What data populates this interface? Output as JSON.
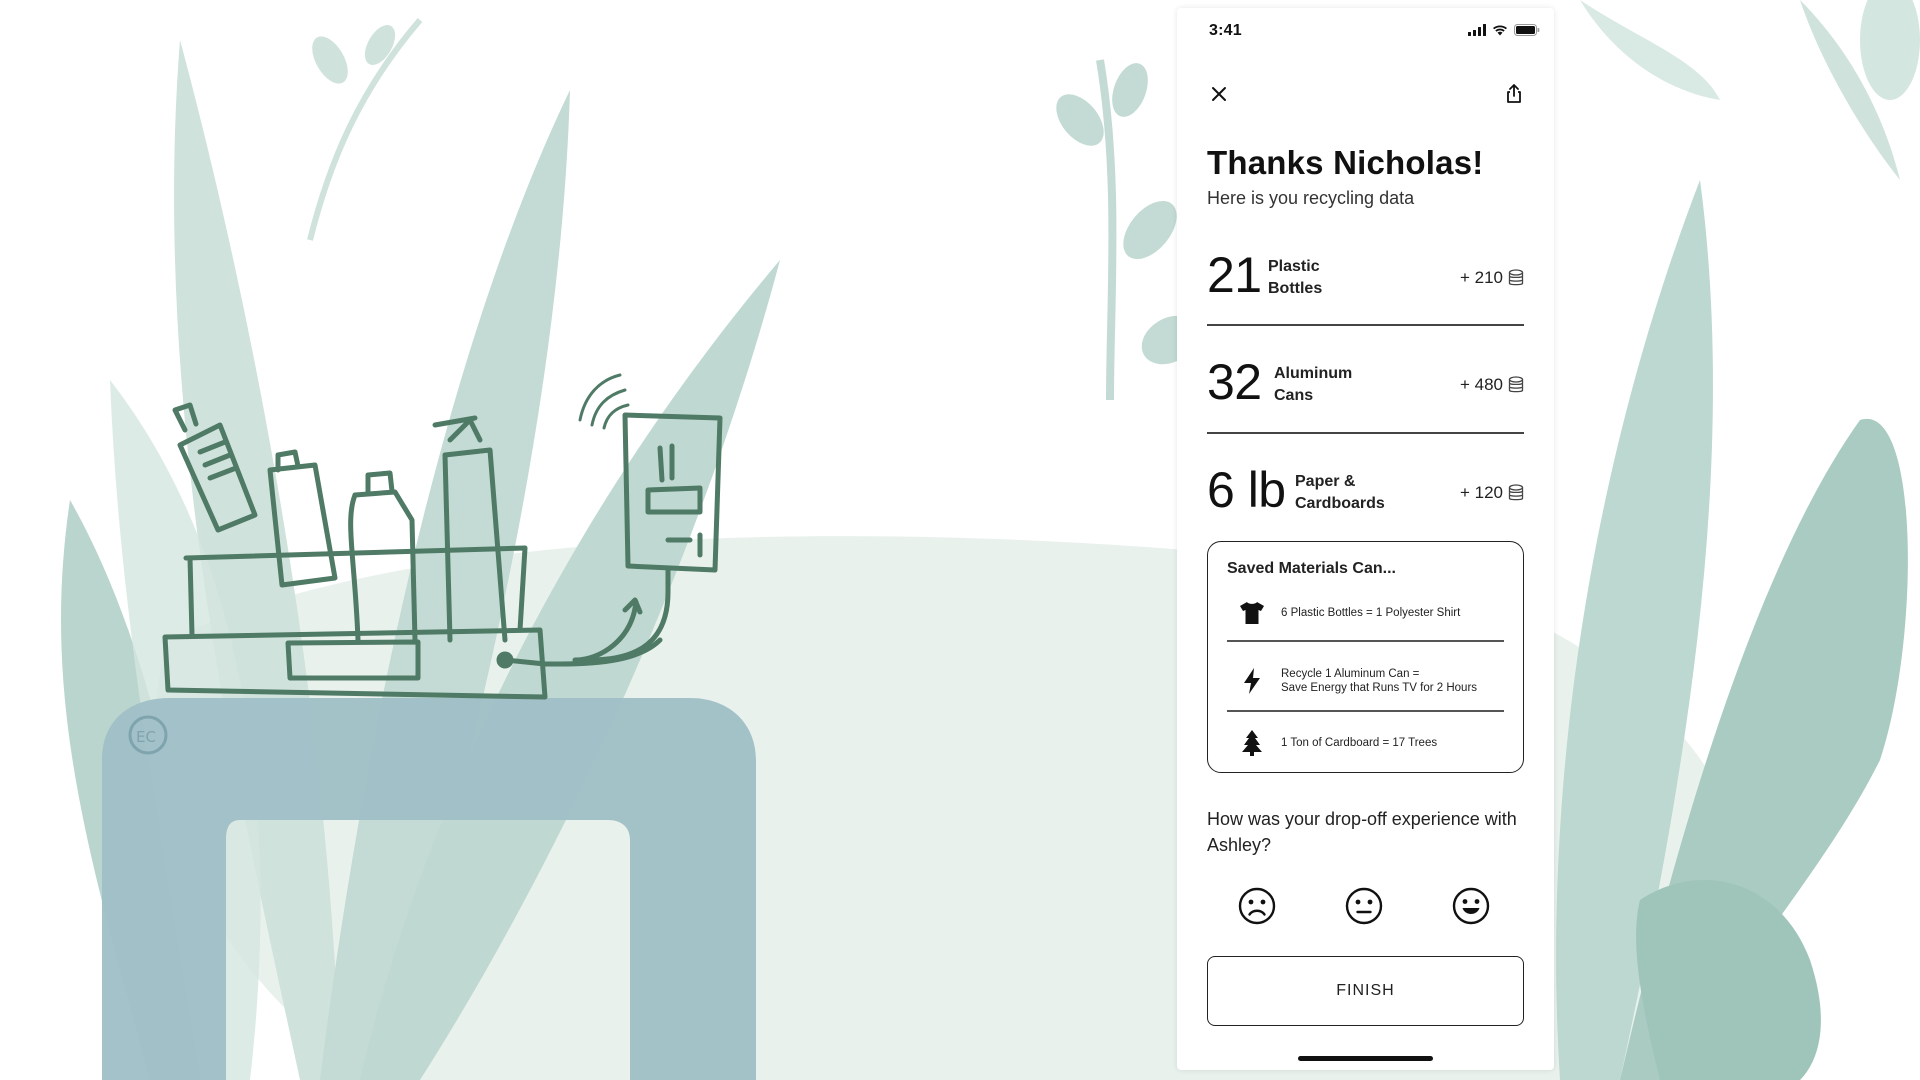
{
  "status_bar": {
    "time": "3:41"
  },
  "header": {
    "title": "Thanks Nicholas!",
    "subtitle": "Here is you recycling data"
  },
  "stats": [
    {
      "number": "21",
      "label_line1": "Plastic",
      "label_line2": "Bottles",
      "points": "+ 210"
    },
    {
      "number": "32",
      "label_line1": "Aluminum",
      "label_line2": "Cans",
      "points": "+ 480"
    },
    {
      "number": "6 lb",
      "label_line1": "Paper &",
      "label_line2": "Cardboards",
      "points": "+ 120"
    }
  ],
  "saved_materials": {
    "title": "Saved Materials Can...",
    "items": [
      {
        "icon": "shirt-icon",
        "line1": "6 Plastic Bottles = 1 Polyester Shirt",
        "line2": ""
      },
      {
        "icon": "lightning-icon",
        "line1": "Recycle 1 Aluminum Can =",
        "line2": "Save Energy that Runs TV for 2 Hours"
      },
      {
        "icon": "tree-icon",
        "line1": "1 Ton of Cardboard = 17 Trees",
        "line2": ""
      }
    ]
  },
  "feedback": {
    "question": "How was your drop-off experience with Ashley?",
    "options": [
      "sad-face-icon",
      "neutral-face-icon",
      "happy-face-icon"
    ]
  },
  "finish_label": "FINISH",
  "colors": {
    "leaf_light": "#d9e9e4",
    "leaf_mid": "#bcd8d1",
    "leaf_dark": "#9fc5bb",
    "table": "#9fbfc6",
    "sketch": "#4f7a66"
  }
}
